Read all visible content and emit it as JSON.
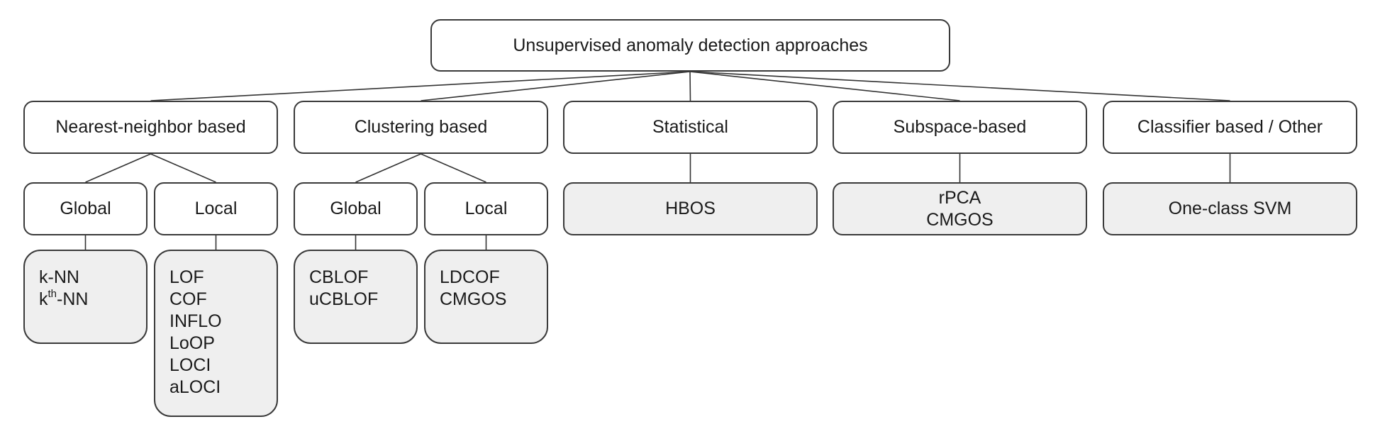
{
  "root": {
    "label": "Unsupervised anomaly detection approaches"
  },
  "categories": [
    {
      "label": "Nearest-neighbor based",
      "subgroups": [
        {
          "label": "Global",
          "methods": [
            "k-NN",
            "k^th-NN"
          ]
        },
        {
          "label": "Local",
          "methods": [
            "LOF",
            "COF",
            "INFLO",
            "LoOP",
            "LOCI",
            "aLOCI"
          ]
        }
      ]
    },
    {
      "label": "Clustering based",
      "subgroups": [
        {
          "label": "Global",
          "methods": [
            "CBLOF",
            "uCBLOF"
          ]
        },
        {
          "label": "Local",
          "methods": [
            "LDCOF",
            "CMGOS"
          ]
        }
      ]
    },
    {
      "label": "Statistical",
      "methods": [
        "HBOS"
      ]
    },
    {
      "label": "Subspace-based",
      "methods": [
        "rPCA",
        "CMGOS"
      ]
    },
    {
      "label": "Classifier based / Other",
      "methods": [
        "One-class SVM"
      ]
    }
  ],
  "colors": {
    "leaf_fill": "#efefef",
    "border": "#3a3a3a",
    "background": "#ffffff"
  }
}
